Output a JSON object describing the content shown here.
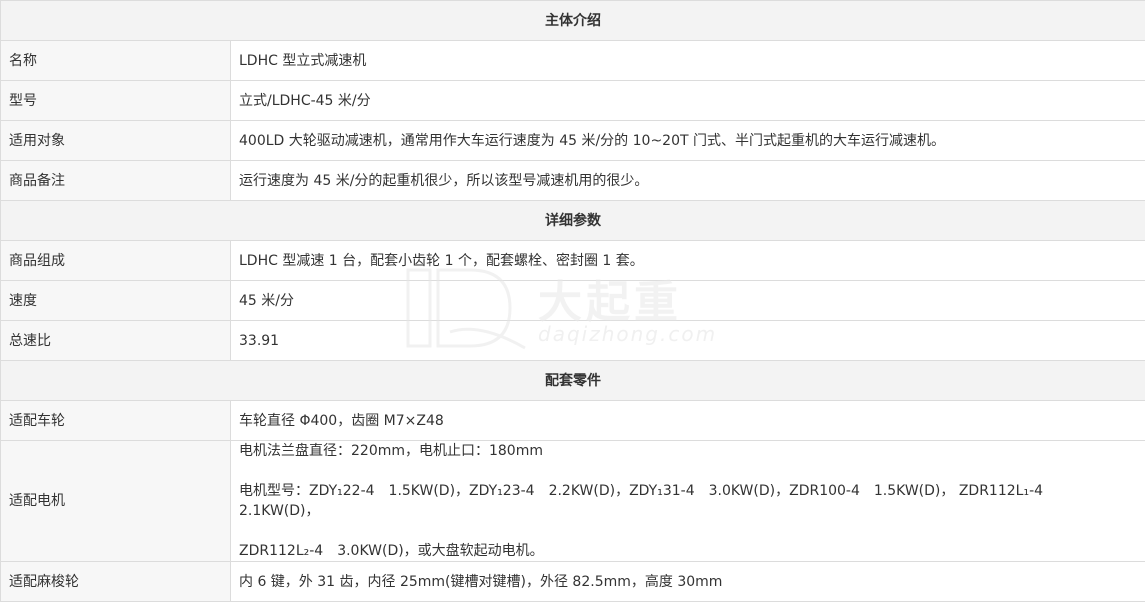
{
  "sections": {
    "intro_title": "主体介绍",
    "detail_title": "详细参数",
    "parts_title": "配套零件"
  },
  "intro": {
    "name_label": "名称",
    "name_value": "LDHC 型立式减速机",
    "model_label": "型号",
    "model_value": "立式/LDHC-45 米/分",
    "usage_label": "适用对象",
    "usage_value": "400LD 大轮驱动减速机，通常用作大车运行速度为 45 米/分的 10~20T 门式、半门式起重机的大车运行减速机。",
    "note_label": "商品备注",
    "note_value": "运行速度为 45 米/分的起重机很少，所以该型号减速机用的很少。"
  },
  "detail": {
    "composition_label": "商品组成",
    "composition_value": "LDHC 型减速 1 台，配套小齿轮 1 个，配套螺栓、密封圈 1 套。",
    "speed_label": "速度",
    "speed_value": "45  米/分",
    "ratio_label": "总速比",
    "ratio_value": "33.91"
  },
  "parts": {
    "wheel_label": "适配车轮",
    "wheel_value": "车轮直径 Φ400，齿圈 M7×Z48",
    "motor_label": "适配电机",
    "motor_line1": "电机法兰盘直径：220mm，电机止口：180mm",
    "motor_line2": "电机型号：ZDY₁22-4　1.5KW(D)，ZDY₁23-4　2.2KW(D)，ZDY₁31-4　3.0KW(D)，ZDR100-4　1.5KW(D)， ZDR112L₁-4　2.1KW(D)，",
    "motor_line3": "ZDR112L₂-4　3.0KW(D)，或大盘软起动电机。",
    "coupling_label": "适配麻梭轮",
    "coupling_value": "内 6 键，外 31 齿，内径 25mm(键槽对键槽)，外径 82.5mm，高度 30mm"
  },
  "watermark": {
    "cn": "大起重",
    "en": "daqizhong.com"
  }
}
